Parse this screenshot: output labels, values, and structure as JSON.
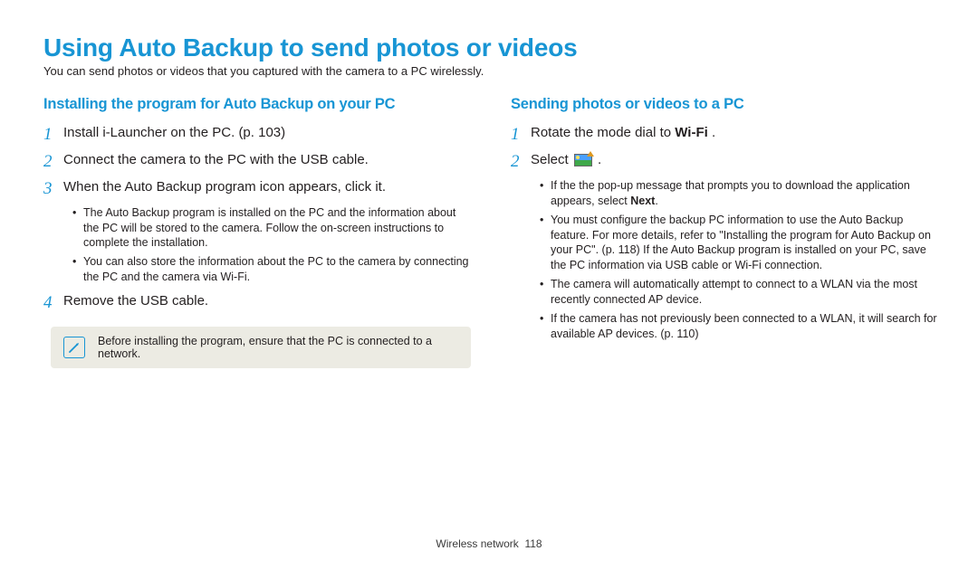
{
  "title": "Using Auto Backup to send photos or videos",
  "intro": "You can send photos or videos that you captured with the camera to a PC wirelessly.",
  "left": {
    "heading": "Installing the program for Auto Backup on your PC",
    "steps": {
      "s1": "Install i-Launcher on the PC. (p. 103)",
      "s2": "Connect the camera to the PC with the USB cable.",
      "s3": "When the Auto Backup program icon appears, click it.",
      "s3_notes": {
        "a": "The Auto Backup program is installed on the PC and the information about the PC will be stored to the camera. Follow the on-screen instructions to complete the installation.",
        "b": "You can also store the information about the PC to the camera by connecting the PC and the camera via Wi-Fi."
      },
      "s4": "Remove the USB cable."
    },
    "tip": "Before installing the program, ensure that the PC is connected to a network."
  },
  "right": {
    "heading": "Sending photos or videos to a PC",
    "steps": {
      "s1_pre": "Rotate the mode dial to ",
      "s1_wifi": "Wi-Fi",
      "s1_post": " .",
      "s2_pre": "Select ",
      "s2_post": " .",
      "s2_notes": {
        "a_pre": "If the the pop-up message that prompts you to download the application appears, select ",
        "a_bold": "Next",
        "a_post": ".",
        "b": "You must configure the backup PC information to use the Auto Backup feature. For more details, refer to \"Installing the program for Auto Backup on your PC\". (p. 118) If the Auto Backup program is installed on your PC, save the PC information via USB cable or Wi-Fi connection.",
        "c": "The camera will automatically attempt to connect to a WLAN via the most recently connected AP device.",
        "d": "If the camera has not previously been connected to a WLAN, it will search for available AP devices. (p. 110)"
      }
    }
  },
  "footer": {
    "section": "Wireless network",
    "page": "118"
  }
}
